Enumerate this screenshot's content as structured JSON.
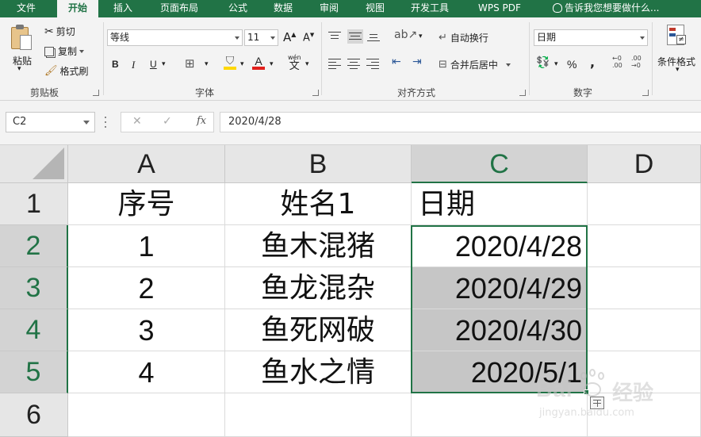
{
  "menu_tabs": [
    "文件",
    "开始",
    "插入",
    "页面布局",
    "公式",
    "数据",
    "审阅",
    "视图",
    "开发工具",
    "WPS PDF"
  ],
  "active_tab_index": 1,
  "tell_me": "告诉我您想要做什么...",
  "ribbon": {
    "clipboard": {
      "paste": "粘贴",
      "cut": "剪切",
      "copy": "复制",
      "format_painter": "格式刷",
      "group_label": "剪贴板"
    },
    "font": {
      "font_name": "等线",
      "font_size": "11",
      "bold": "B",
      "italic": "I",
      "underline": "U",
      "group_label": "字体",
      "wen": "wén",
      "wen_char": "文",
      "grow": "A",
      "shrink": "A",
      "font_color_letter": "A"
    },
    "alignment": {
      "wrap_text": "自动换行",
      "merge_center": "合并后居中",
      "group_label": "对齐方式"
    },
    "number": {
      "format": "日期",
      "percent": "%",
      "comma": ",",
      "group_label": "数字"
    },
    "styles": {
      "conditional_format": "条件格式"
    }
  },
  "formula_bar": {
    "name_box": "C2",
    "cancel": "✕",
    "enter": "✓",
    "fx": "fx",
    "value": "2020/4/28"
  },
  "sheet": {
    "columns": [
      "A",
      "B",
      "C",
      "D"
    ],
    "rows": [
      "1",
      "2",
      "3",
      "4",
      "5",
      "6"
    ],
    "selected_column": "C",
    "selected_rows": [
      "2",
      "3",
      "4",
      "5"
    ],
    "headers": [
      "序号",
      "姓名1",
      "日期"
    ],
    "data": [
      {
        "no": "1",
        "name": "鱼木混猪",
        "date": "2020/4/28"
      },
      {
        "no": "2",
        "name": "鱼龙混杂",
        "date": "2020/4/29"
      },
      {
        "no": "3",
        "name": "鱼死网破",
        "date": "2020/4/30"
      },
      {
        "no": "4",
        "name": "鱼水之情",
        "date": "2020/5/1"
      }
    ]
  },
  "watermark": {
    "brand": "Bai",
    "brand_cn": "经验",
    "url": "jingyan.baidu.com"
  },
  "colors": {
    "excel_green": "#217346",
    "selection_fill": "#c6c6c6",
    "font_highlight": "#ffd800",
    "font_color": "#e2201c"
  }
}
